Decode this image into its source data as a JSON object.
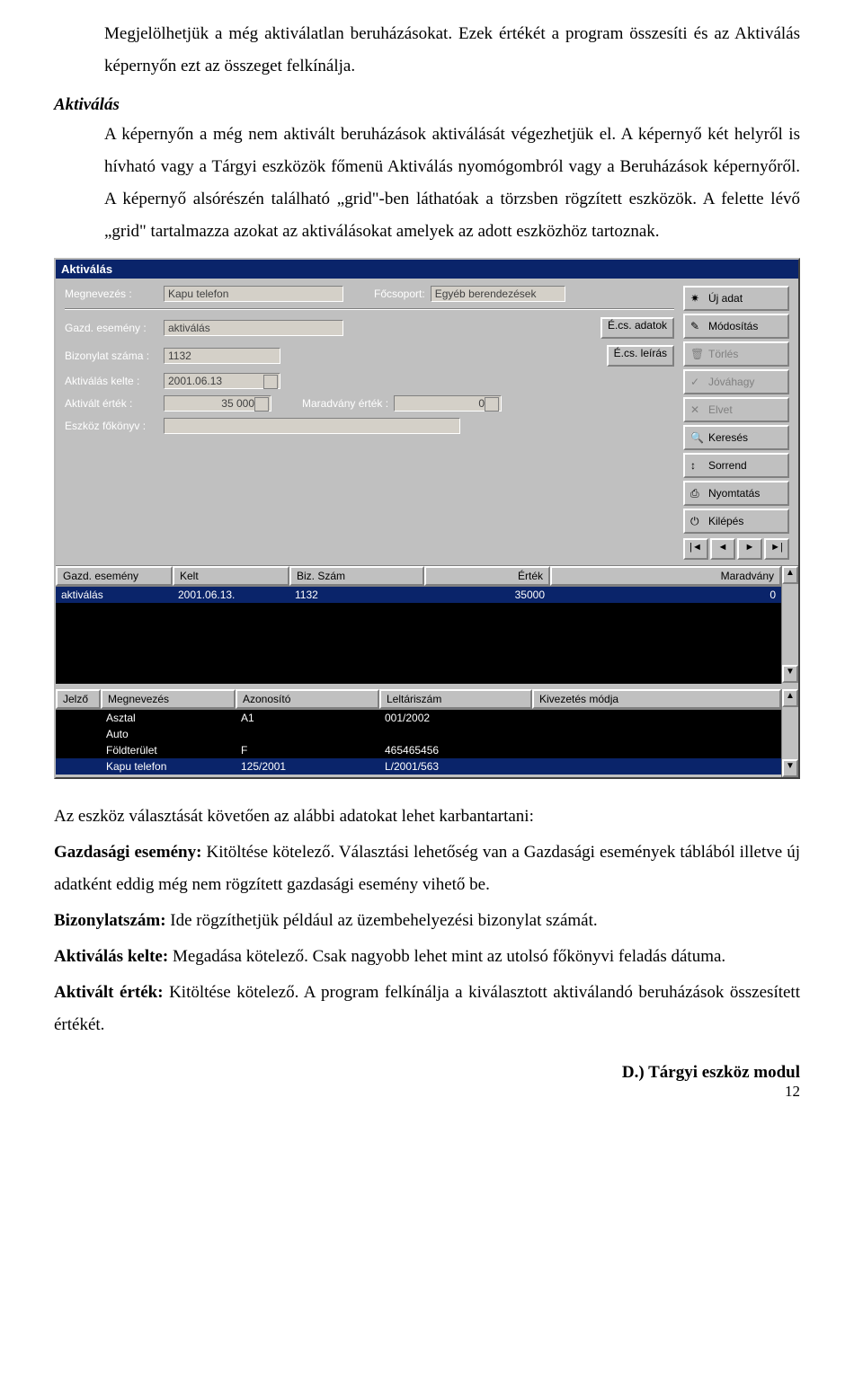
{
  "paragraphs": {
    "intro1": "Megjelölhetjük a még aktiválatlan beruházásokat. Ezek értékét a program összesíti és az Aktiválás képernyőn ezt az összeget felkínálja.",
    "heading": "Aktiválás",
    "intro2": "A képernyőn a még nem aktivált beruházások aktiválását végezhetjük el. A képernyő két helyről is hívható vagy a Tárgyi eszközök főmenü Aktiválás nyomógombról vagy a Beruházások képernyőről. A képernyő alsórészén található „grid\"-ben láthatóak a törzsben rögzített eszközök. A felette lévő „grid\" tartalmazza azokat az aktiválásokat amelyek az adott eszközhöz tartoznak."
  },
  "window": {
    "title": "Aktiválás",
    "form": {
      "megnevezes_label": "Megnevezés :",
      "megnevezes_value": "Kapu telefon",
      "focsoport_label": "Főcsoport:",
      "focsoport_value": "Egyéb berendezések",
      "gazd_label": "Gazd. esemény :",
      "gazd_value": "aktiválás",
      "biz_label": "Bizonylat száma :",
      "biz_value": "1132",
      "aktkelte_label": "Aktiválás kelte :",
      "aktkelte_value": "2001.06.13",
      "aktert_label": "Aktivált érték :",
      "aktert_value": "35 000",
      "marad_label": "Maradvány érték :",
      "marad_value": "0",
      "eszfk_label": "Eszköz főkönyv :",
      "ecsadatok": "É.cs. adatok",
      "ecsleiras": "É.cs. leírás"
    },
    "buttons": {
      "ujadat": "Új adat",
      "modositas": "Módosítás",
      "torles": "Törlés",
      "jovahagy": "Jóváhagy",
      "elvet": "Elvet",
      "kereses": "Keresés",
      "sorrend": "Sorrend",
      "nyomtatas": "Nyomtatás",
      "kilepes": "Kilépés"
    },
    "grid1": {
      "headers": [
        "Gazd. esemény",
        "Kelt",
        "Biz. Szám",
        "Érték",
        "Maradvány"
      ],
      "rows": [
        {
          "c1": "aktiválás",
          "c2": "2001.06.13.",
          "c3": "1132",
          "c4": "35000",
          "c5": "0",
          "selected": true
        }
      ]
    },
    "grid2": {
      "headers": [
        "Jelző",
        "Megnevezés",
        "Azonosító",
        "Leltáriszám",
        "Kivezetés módja"
      ],
      "rows": [
        {
          "d1": "",
          "d2": "Asztal",
          "d3": "A1",
          "d4": "001/2002",
          "d5": "",
          "selected": false
        },
        {
          "d1": "",
          "d2": "Auto",
          "d3": "",
          "d4": "",
          "d5": "",
          "selected": false
        },
        {
          "d1": "",
          "d2": "Földterület",
          "d3": "F",
          "d4": "465465456",
          "d5": "",
          "selected": false
        },
        {
          "d1": "",
          "d2": "Kapu telefon",
          "d3": "125/2001",
          "d4": "L/2001/563",
          "d5": "",
          "selected": true
        }
      ]
    },
    "nav": {
      "first": "|◄",
      "prev": "◄",
      "next": "►",
      "last": "►|"
    }
  },
  "outro": {
    "p1": "Az eszköz választását követően az alábbi adatokat lehet karbantartani:",
    "b1": "Gazdasági esemény:",
    "t1": " Kitöltése kötelező. Választási lehetőség van a Gazdasági események táblából illetve új adatként eddig még nem rögzített gazdasági esemény vihető be.",
    "b2": "Bizonylatszám:",
    "t2": " Ide rögzíthetjük például az üzembehelyezési bizonylat számát.",
    "b3": "Aktiválás kelte:",
    "t3": " Megadása kötelező. Csak nagyobb lehet mint az utolsó főkönyvi feladás dátuma.",
    "b4": "Aktivált érték:",
    "t4": " Kitöltése kötelező. A program felkínálja a kiválasztott aktiválandó beruházások összesített értékét."
  },
  "footer": {
    "module": "D.) Tárgyi eszköz modul",
    "page": "12"
  }
}
